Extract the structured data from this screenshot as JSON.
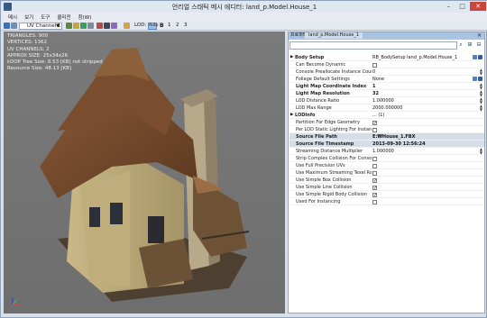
{
  "window": {
    "title": "언리얼 스태틱 메시 에디터: land_p.Model.House_1",
    "min_label": "–",
    "max_label": "□",
    "close_label": "✕"
  },
  "menu": [
    "메시",
    "보기",
    "도구",
    "콜리전",
    "창(W)"
  ],
  "toolbar": {
    "uv_channel": "UV Channel 1",
    "lod_label": "LOD:",
    "lod_auto": "Auto",
    "lod_base": "B",
    "lod_levels": [
      "1",
      "2",
      "3"
    ]
  },
  "viewport": {
    "stats": [
      "TRIANGLES:  900",
      "VERTICES:  1362",
      "UV CHANNELS:  2",
      "APPROX SIZE: 25x34x26",
      "kDOP Tree Size: 8.53 [KB] not stripped",
      "Resource Size:  48.13 [KB]"
    ]
  },
  "properties": {
    "title": "프로퍼티",
    "tab": "land_p.Model.House_1",
    "rows": [
      {
        "name": "Body Setup",
        "value": "RB_BodySetup land_p.Model.House_1",
        "kind": "group"
      },
      {
        "name": "Can Become Dynamic",
        "value": "",
        "kind": "check",
        "checked": false
      },
      {
        "name": "Console Preallocate Instance Count",
        "value": "0",
        "kind": "text"
      },
      {
        "name": "Foliage Default Settings",
        "value": "None",
        "kind": "text"
      },
      {
        "name": "Light Map Coordinate Index",
        "value": "1",
        "kind": "bold"
      },
      {
        "name": "Light Map Resolution",
        "value": "32",
        "kind": "bold"
      },
      {
        "name": "LOD Distance Ratio",
        "value": "1.000000",
        "kind": "text"
      },
      {
        "name": "LOD Max Range",
        "value": "2000.000000",
        "kind": "text"
      },
      {
        "name": "LODInfo",
        "value": "... (1)",
        "kind": "group"
      },
      {
        "name": "Partition For Edge Geometry",
        "value": "",
        "kind": "check",
        "checked": true
      },
      {
        "name": "Per LOD Static Lighting For Instancing",
        "value": "",
        "kind": "check",
        "checked": false
      },
      {
        "name": "Source File Path",
        "value": "E:₩House_1.FBX",
        "kind": "hl"
      },
      {
        "name": "Source File Timestamp",
        "value": "2013-09-30 12:56:24",
        "kind": "hl"
      },
      {
        "name": "Streaming Distance Multiplier",
        "value": "1.000000",
        "kind": "text"
      },
      {
        "name": "Strip Complex Collision For Console",
        "value": "",
        "kind": "check",
        "checked": false
      },
      {
        "name": "Use Full Precision UVs",
        "value": "",
        "kind": "check",
        "checked": false
      },
      {
        "name": "Use Maximum Streaming Texel Ratio",
        "value": "",
        "kind": "check",
        "checked": false
      },
      {
        "name": "Use Simple Box Collision",
        "value": "",
        "kind": "check",
        "checked": true
      },
      {
        "name": "Use Simple Line Collision",
        "value": "",
        "kind": "check",
        "checked": true
      },
      {
        "name": "Use Simple Rigid Body Collision",
        "value": "",
        "kind": "check",
        "checked": true
      },
      {
        "name": "Used For Instancing",
        "value": "",
        "kind": "check",
        "checked": false
      }
    ]
  }
}
